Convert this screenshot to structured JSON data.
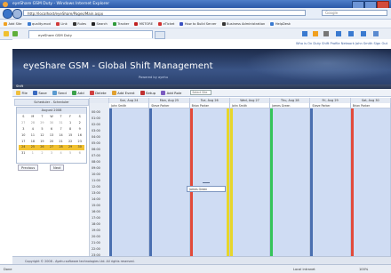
{
  "window": {
    "title": "eyeShare GSM Duty - Windows Internet Explorer"
  },
  "address": {
    "url": "http://localhost/eyeShare/Pages/Main.aspx",
    "search_placeholder": "Google"
  },
  "favorites": [
    "Add Site",
    "quality.mod",
    "Link",
    "Rules",
    "Search",
    "Tracker",
    "MSTORE",
    "eTicket",
    "How to Build Server",
    "Business Administration",
    "HelpDesk"
  ],
  "tab": {
    "label": "eyeShare GSM Duty"
  },
  "page_links": "Who is On Duty   Shift Profile   Network   John Smith   Sign Out",
  "banner": {
    "title": "eyeShare GSM - Global Shift Management",
    "subtitle": "Powered by ayehu"
  },
  "strip_label": "Shift",
  "toolbar": [
    "File",
    "Save",
    "Send",
    "Add",
    "Delete",
    "Add Event",
    "Setup",
    "Add Role"
  ],
  "toolbar_select": "Select Site",
  "left_panel": {
    "header": "Scheduler - Scheduler",
    "prev": "Previous",
    "next": "Next"
  },
  "calendar": {
    "month": "August 2008",
    "weekdays": [
      "S",
      "M",
      "T",
      "W",
      "T",
      "F",
      "S"
    ],
    "days": [
      "27",
      "28",
      "29",
      "30",
      "31",
      "1",
      "2",
      "3",
      "4",
      "5",
      "6",
      "7",
      "8",
      "9",
      "10",
      "11",
      "12",
      "13",
      "14",
      "15",
      "16",
      "17",
      "18",
      "19",
      "20",
      "21",
      "22",
      "23",
      "24",
      "25",
      "26",
      "27",
      "28",
      "29",
      "30",
      "31",
      "1",
      "2",
      "3",
      "4",
      "5",
      "6"
    ],
    "highlight_week": [
      "24",
      "25",
      "26",
      "27",
      "28",
      "29",
      "30"
    ]
  },
  "schedule": {
    "days": [
      "Sun, Aug 24",
      "Mon, Aug 25",
      "Tue, Aug 26",
      "Wed, Aug 27",
      "Thu, Aug 28",
      "Fri, Aug 29",
      "Sat, Aug 30"
    ],
    "resources": [
      "John Smith",
      "Steve Parker",
      "Brian Parker",
      "John Smith",
      "James Green",
      "Steve Parker",
      "Brian Parker"
    ],
    "stripe_colors": [
      "#4a6fb0",
      "#4a6fb0",
      "#e24a3a",
      "#e7d629",
      "#36c45a",
      "#4a6fb0",
      "#e24a3a"
    ],
    "stripe2_colors": [
      "",
      "",
      "#e7d629",
      "",
      "",
      "",
      ""
    ],
    "times": [
      "00:00",
      "01:00",
      "02:00",
      "03:00",
      "04:00",
      "05:00",
      "06:00",
      "07:00",
      "08:00",
      "09:00",
      "10:00",
      "11:00",
      "12:00",
      "13:00",
      "14:00",
      "15:00",
      "16:00",
      "17:00",
      "18:00",
      "19:00",
      "20:00",
      "21:00",
      "22:00",
      "23:00"
    ],
    "shift_label": "James Green"
  },
  "footer": "Copyright © 2008 - Ayehu software technologies Ltd. All rights reserved.",
  "status": {
    "left": "Done",
    "zone": "Local intranet",
    "zoom": "100%"
  }
}
